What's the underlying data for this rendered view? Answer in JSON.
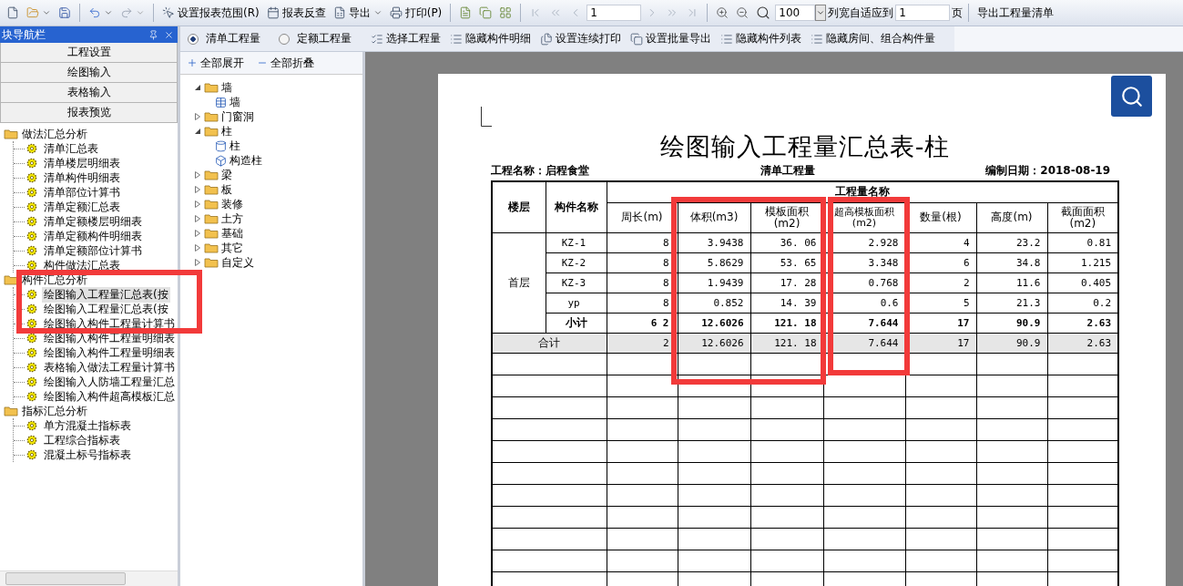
{
  "toolbar": {
    "report_buttons": [
      {
        "label": "设置报表范围(R)",
        "kind": "range"
      },
      {
        "label": "报表反查",
        "kind": "lookup"
      },
      {
        "label": "导出",
        "kind": "export"
      },
      {
        "label": "打印(P)",
        "kind": "print"
      }
    ],
    "page_field": "1",
    "zoom_field": "100",
    "fit_label": "列宽自适应到",
    "fit_field": "1",
    "fit_unit": "页",
    "export_button": "导出工程量清单"
  },
  "quantity_toolbar": {
    "options": [
      {
        "label": "清单工程量",
        "selected": true
      },
      {
        "label": "定额工程量",
        "selected": false
      }
    ],
    "buttons": [
      {
        "label": "选择工程量",
        "kind": "select"
      },
      {
        "label": "隐藏构件明细",
        "kind": "hide"
      },
      {
        "label": "设置连续打印",
        "kind": "print"
      },
      {
        "label": "设置批量导出",
        "kind": "batch"
      },
      {
        "label": "隐藏构件列表",
        "kind": "hide"
      },
      {
        "label": "隐藏房间、组合构件量",
        "kind": "hide"
      }
    ]
  },
  "navigator": {
    "title": "块导航栏",
    "sections": [
      "工程设置",
      "绘图输入",
      "表格输入",
      "报表预览"
    ],
    "tree": [
      {
        "label": "做法汇总分析",
        "children": [
          {
            "label": "清单汇总表",
            "selected": false
          },
          {
            "label": "清单楼层明细表",
            "selected": false
          },
          {
            "label": "清单构件明细表",
            "selected": false
          },
          {
            "label": "清单部位计算书",
            "selected": false
          },
          {
            "label": "清单定额汇总表",
            "selected": false
          },
          {
            "label": "清单定额楼层明细表",
            "selected": false
          },
          {
            "label": "清单定额构件明细表",
            "selected": false
          },
          {
            "label": "清单定额部位计算书",
            "selected": false
          },
          {
            "label": "构件做法汇总表",
            "selected": false
          }
        ]
      },
      {
        "label": "构件汇总分析",
        "children": [
          {
            "label": "绘图输入工程量汇总表(按",
            "selected": true
          },
          {
            "label": "绘图输入工程量汇总表(按",
            "selected": false
          },
          {
            "label": "绘图输入构件工程量计算书",
            "selected": false
          },
          {
            "label": "绘图输入构件工程量明细表",
            "selected": false
          },
          {
            "label": "绘图输入构件工程量明细表",
            "selected": false
          },
          {
            "label": "表格输入做法工程量计算书",
            "selected": false
          },
          {
            "label": "绘图输入人防墙工程量汇总",
            "selected": false
          },
          {
            "label": "绘图输入构件超高模板汇总",
            "selected": false
          }
        ]
      },
      {
        "label": "指标汇总分析",
        "children": [
          {
            "label": "单方混凝土指标表",
            "selected": false
          },
          {
            "label": "工程综合指标表",
            "selected": false
          },
          {
            "label": "混凝土标号指标表",
            "selected": false
          }
        ]
      }
    ]
  },
  "component_tree": {
    "expand_all": "全部展开",
    "collapse_all": "全部折叠",
    "items": [
      {
        "label": "墙",
        "expanded": true,
        "children": [
          {
            "label": "墙",
            "kind": "wall"
          }
        ]
      },
      {
        "label": "门窗洞",
        "expanded": false
      },
      {
        "label": "柱",
        "expanded": true,
        "children": [
          {
            "label": "柱",
            "kind": "column"
          },
          {
            "label": "构造柱",
            "kind": "structural"
          }
        ]
      },
      {
        "label": "梁",
        "expanded": false
      },
      {
        "label": "板",
        "expanded": false
      },
      {
        "label": "装修",
        "expanded": false
      },
      {
        "label": "土方",
        "expanded": false
      },
      {
        "label": "基础",
        "expanded": false
      },
      {
        "label": "其它",
        "expanded": false
      },
      {
        "label": "自定义",
        "expanded": false
      }
    ]
  },
  "report": {
    "title": "绘图输入工程量汇总表-柱",
    "project": "工程名称：启程食堂",
    "quantity_type": "清单工程量",
    "date": "编制日期：2018-08-19",
    "columns": {
      "floor": "楼层",
      "name": "构件名称",
      "group": "工程量名称",
      "quantities": [
        "周长(m)",
        "体积(m3)",
        "模板面积(m2)",
        "超高模板面积(m2)",
        "数量(根)",
        "高度(m)",
        "截面面积(m2)"
      ]
    },
    "floors": [
      {
        "floor": "首层",
        "rows": [
          {
            "name": "KZ-1",
            "cells": [
              "8",
              "3.9438",
              "36. 06",
              "2.928",
              "4",
              "23.2",
              "0.81"
            ]
          },
          {
            "name": "KZ-2",
            "cells": [
              "8",
              "5.8629",
              "53. 65",
              "3.348",
              "6",
              "34.8",
              "1.215"
            ]
          },
          {
            "name": "KZ-3",
            "cells": [
              "8",
              "1.9439",
              "17. 28",
              "0.768",
              "2",
              "11.6",
              "0.405"
            ]
          },
          {
            "name": "yp",
            "cells": [
              "8",
              "0.852",
              "14. 39",
              "0.6",
              "5",
              "21.3",
              "0.2"
            ]
          }
        ],
        "subtotal": {
          "label": "小计",
          "cells": [
            "6 2",
            "12.6026",
            "121. 18",
            "7.644",
            "17",
            "90.9",
            "2.63"
          ]
        }
      }
    ],
    "total": {
      "label": "合计",
      "cells": [
        "2",
        "12.6026",
        "121. 18",
        "7.644",
        "17",
        "90.9",
        "2.63"
      ]
    }
  }
}
